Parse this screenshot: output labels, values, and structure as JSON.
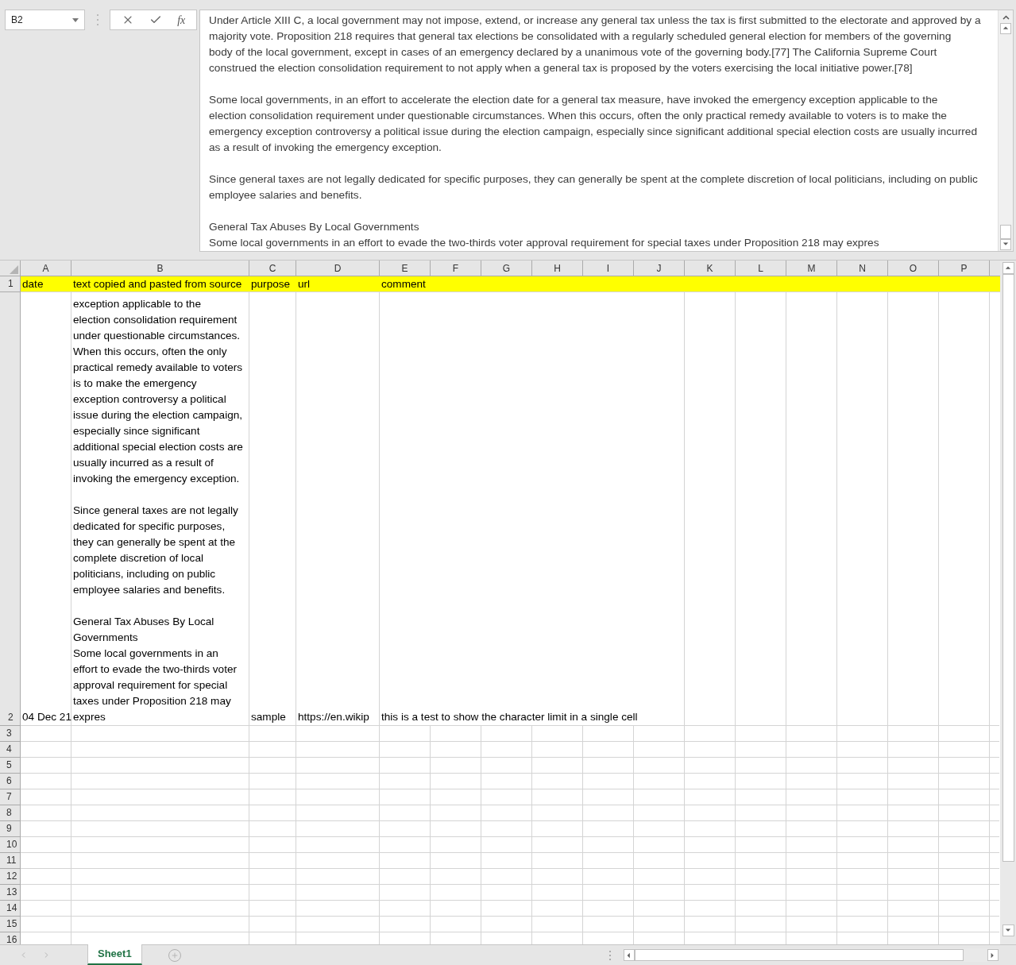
{
  "name_box": {
    "value": "B2"
  },
  "formula_bar": {
    "fx": "fx",
    "paragraphs": [
      [
        "Under Article XIII C, a local government may not impose, extend, or increase any general tax unless the tax is first submitted to the electorate and approved by a",
        "majority vote. Proposition 218 requires that general tax elections be consolidated with a regularly scheduled general election for members of the governing",
        "body of the local government, except in cases of an emergency declared by a unanimous vote of the governing body.[77] The California Supreme Court",
        "construed the election consolidation requirement to not apply when a general tax is proposed by the voters exercising the local initiative power.[78]"
      ],
      [
        "Some local governments, in an effort to accelerate the election date for a general tax measure, have invoked the emergency exception applicable to the",
        "election consolidation requirement under questionable circumstances. When this occurs, often the only practical remedy available to voters is to make the",
        "emergency exception controversy a political issue during the election campaign, especially since significant additional special election costs are usually incurred",
        "as a result of invoking the emergency exception."
      ],
      [
        "Since general taxes are not legally dedicated for specific purposes, they can generally be spent at the complete discretion of local politicians, including on public",
        "employee salaries and benefits."
      ],
      [
        "General Tax Abuses By Local Governments",
        "Some local governments in an effort to evade the two-thirds voter approval requirement for special taxes under Proposition 218 may expres"
      ]
    ]
  },
  "columns": [
    "A",
    "B",
    "C",
    "D",
    "E",
    "F",
    "G",
    "H",
    "I",
    "J",
    "K",
    "L",
    "M",
    "N",
    "O",
    "P"
  ],
  "rows": [
    {
      "number": "1",
      "highlighted": true,
      "cells": [
        "date",
        "text copied and pasted from source",
        "purpose",
        "url",
        "comment"
      ]
    },
    {
      "number": "2",
      "date": "04 Dec 21",
      "text_paragraphs": [
        [
          "exception applicable to the",
          "election consolidation requirement",
          "under questionable circumstances.",
          "When this occurs, often the only",
          "practical remedy available to voters",
          "is to make the emergency",
          "exception controversy a political",
          "issue during the election campaign,",
          "especially since significant",
          "additional special election costs are",
          "usually incurred as a result of",
          "invoking the emergency exception."
        ],
        [
          "Since general taxes are not legally",
          "dedicated for specific purposes,",
          "they can generally be spent at the",
          "complete discretion of local",
          "politicians, including on public",
          "employee salaries and benefits."
        ],
        [
          "General Tax Abuses By Local",
          "Governments",
          "Some local governments in an",
          "effort to evade the two-thirds voter",
          "approval requirement for special",
          "taxes under Proposition 218 may",
          "expres"
        ]
      ],
      "purpose": "sample",
      "url": "https://en.wikip",
      "comment": "this is a test to show the character limit in a single cell"
    }
  ],
  "empty_rows": [
    "3",
    "4",
    "5",
    "6",
    "7",
    "8",
    "9",
    "10",
    "11",
    "12",
    "13",
    "14",
    "15",
    "16"
  ],
  "sheets": [
    {
      "name": "Sheet1",
      "selected": true
    }
  ]
}
